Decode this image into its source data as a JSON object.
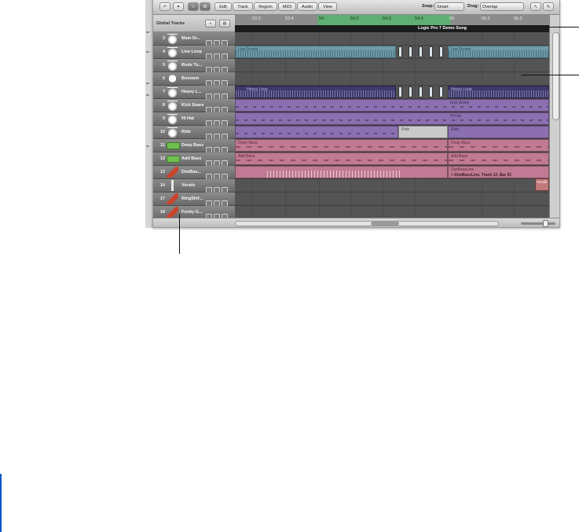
{
  "toolbar": {
    "undo_label": "↶",
    "link_label": "⚭",
    "info_label": "i",
    "gear_label": "⚙",
    "menus": [
      "Edit",
      "Track",
      "Region",
      "MIDI",
      "Audio",
      "View"
    ],
    "snap_label": "Snap:",
    "snap_value": "Smart",
    "drag_label": "Drag:",
    "drag_value": "Overlap",
    "pointer_tool": "↖",
    "pencil_tool": "✎"
  },
  "global_tracks": {
    "label": "Global Tracks",
    "add_label": "+",
    "folder_label": "▤"
  },
  "ruler": {
    "ticks": [
      "53.3",
      "53.4",
      "54",
      "54.2",
      "54.3",
      "54.4",
      "55",
      "55.2",
      "55.3"
    ]
  },
  "marker": {
    "text": "Logic Pro 7  Demo Song"
  },
  "tracks": [
    {
      "num": "3",
      "name": "Main Dr...",
      "icon": "drum-kit-icon"
    },
    {
      "num": "4",
      "name": "Live Loop",
      "icon": "drum-kit-icon"
    },
    {
      "num": "5",
      "name": "Rude Tu...",
      "icon": "drum-kit-icon"
    },
    {
      "num": "6",
      "name": "Boooom",
      "icon": "bass-drum-icon"
    },
    {
      "num": "7",
      "name": "Heavy L...",
      "icon": "drum-kit-icon"
    },
    {
      "num": "8",
      "name": "Kick Snare",
      "icon": "drum-kit-icon"
    },
    {
      "num": "9",
      "name": "Hi Hat",
      "icon": "drum-kit-icon"
    },
    {
      "num": "10",
      "name": "Ride",
      "icon": "drum-kit-icon"
    },
    {
      "num": "11",
      "name": "Deep Bass",
      "icon": "bass-synth-icon"
    },
    {
      "num": "12",
      "name": "Add Bass",
      "icon": "bass-synth-icon"
    },
    {
      "num": "13",
      "name": "DistBas...",
      "icon": "guitar-icon"
    },
    {
      "num": "14",
      "name": "Vocals",
      "icon": "microphone-icon"
    },
    {
      "num": "17",
      "name": "RingShif...",
      "icon": "guitar-icon"
    },
    {
      "num": "18",
      "name": "Funky G...",
      "icon": "guitar-icon"
    }
  ],
  "regions": {
    "live_drums_a": "Live Drums",
    "live_drums_b": "Live Drums",
    "heavy_loop_a": "Heavy Loop",
    "heavy_loop_b": "Heavy Loop",
    "kick_snare": "Kick Snare",
    "hi_hat": "Hi Hat",
    "ride_a": "Ride",
    "ride_b": "Ride",
    "deep_bass_a": "Deep Bass",
    "deep_bass_b": "Deep Bass",
    "add_bass_a": "Add Bass",
    "add_bass_b": "Add Bass",
    "distbass_b": "DistBassLine",
    "distbass_note": "> DistBassLine, Track 13, Bar 51",
    "vocals": "Vocals"
  },
  "colors": {
    "cycle": "#5fae73",
    "audio": "#6f9aa8",
    "midi_purple": "#8c6fb0",
    "midi_pink": "#c07a93",
    "callout_line": "#111111",
    "accent_bar": "#0b56c7"
  }
}
